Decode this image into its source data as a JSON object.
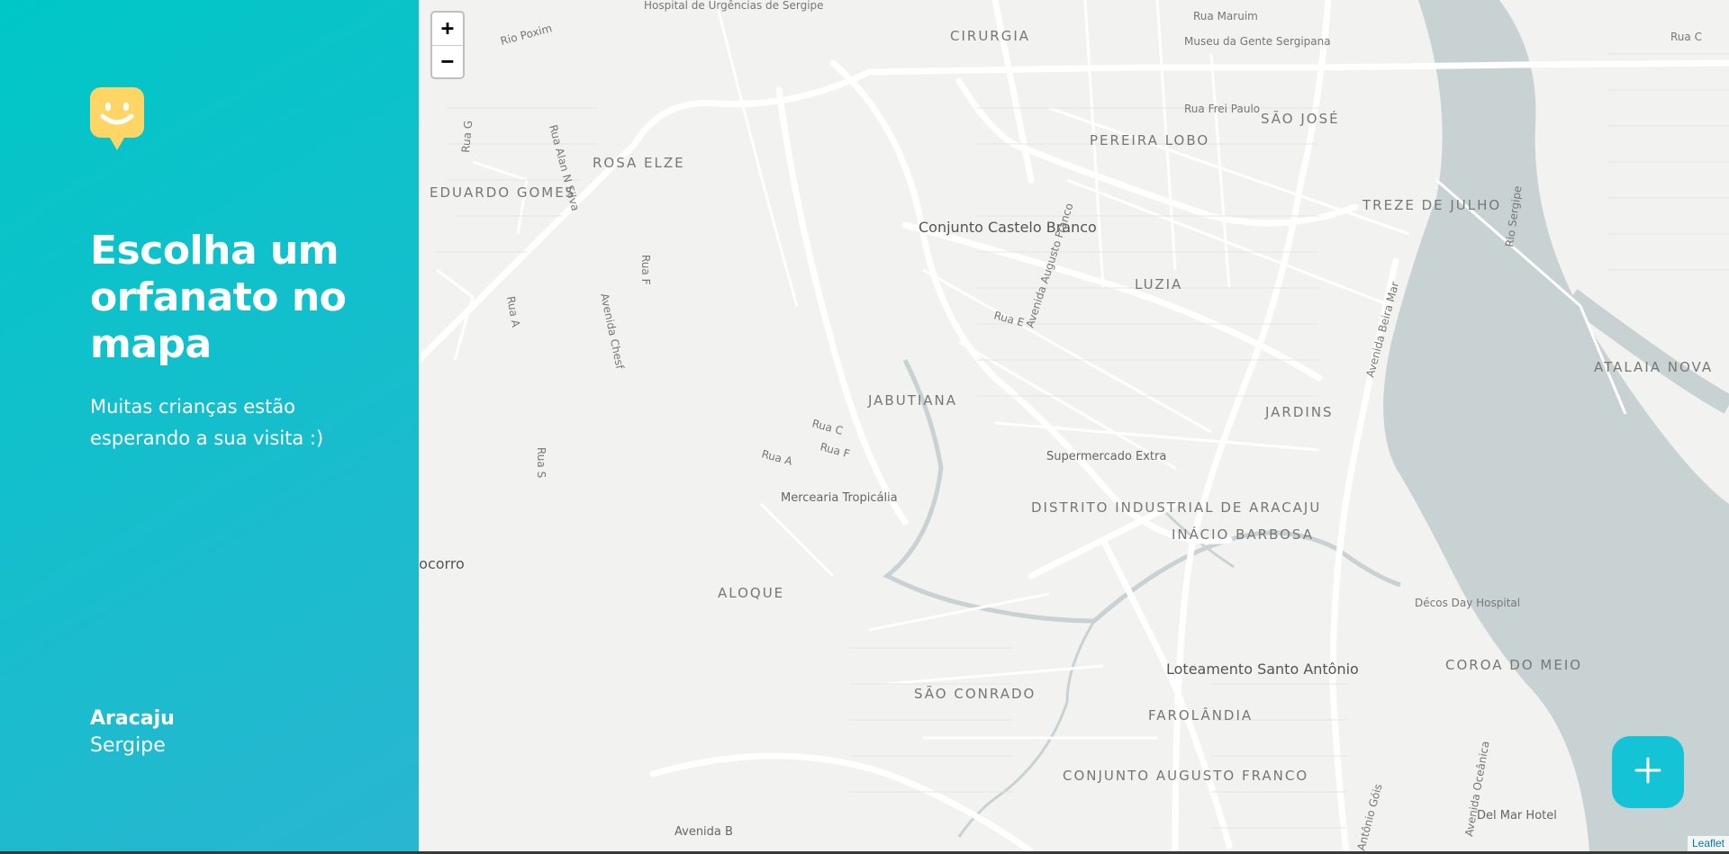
{
  "sidebar": {
    "title": "Escolha um orfanato no mapa",
    "subtitle": "Muitas crianças estão esperando a sua visita :)",
    "city": "Aracaju",
    "state": "Sergipe"
  },
  "map": {
    "zoom_in_label": "+",
    "zoom_out_label": "−",
    "attribution": "Leaflet",
    "labels": [
      "Hospital de Urgências de Sergipe",
      "CIRURGIA",
      "Rua Maruim",
      "Museu da Gente Sergipana",
      "Rua C",
      "Rio Poxim",
      "Rua Frei Paulo",
      "SÃO JOSÉ",
      "PEREIRA LOBO",
      "ROSA ELZE",
      "Rua G",
      "Rua Alan N Silva",
      "EDUARDO GOMES",
      "Conjunto Castelo Branco",
      "Avenida Augusto Franco",
      "TREZE DE JULHO",
      "Rio Sergipe",
      "LUZIA",
      "Rua F",
      "Rua A",
      "Avenida Chesf",
      "Rua E",
      "Avenida Beira Mar",
      "ATALAIA NOVA",
      "JABUTIANA",
      "JARDINS",
      "Rua C",
      "Rua F",
      "Rua A",
      "Supermercado Extra",
      "Rua S",
      "Mercearia Tropicália",
      "DISTRITO INDUSTRIAL DE ARACAJU",
      "INÁCIO BARBOSA",
      "Socorro",
      "ALOQUE",
      "Décos Day Hospital",
      "Loteamento Santo Antônio",
      "SÃO CONRADO",
      "COROA DO MEIO",
      "FAROLÂNDIA",
      "CONJUNTO AUGUSTO FRANCO",
      "Avenida B",
      "Avenida Oceânica",
      "Del Mar Hotel",
      "Antônio Góis"
    ]
  },
  "colors": {
    "gradient_start": "#00C7C7",
    "gradient_end": "#29B6D1",
    "logo": "#FFD666",
    "add_button": "#15C3D6",
    "river": "#c9d2d3"
  },
  "icons": {
    "logo": "happy-face-marker",
    "add": "plus-icon"
  }
}
